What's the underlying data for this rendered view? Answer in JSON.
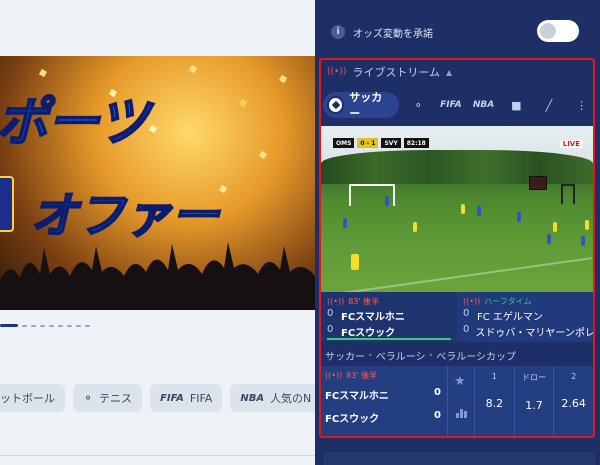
{
  "left": {
    "banner": {
      "title_line1": "ポーツ",
      "title_line2": "オファー"
    },
    "chips": [
      {
        "label": "ットボール",
        "icon": "soccer-icon"
      },
      {
        "label": "テニス",
        "icon": "tennis-icon"
      },
      {
        "logo": "FIFA",
        "label": "FIFA",
        "icon": "fifa-logo"
      },
      {
        "logo": "NBA",
        "label": "人気のN",
        "icon": "nba-logo"
      }
    ]
  },
  "right": {
    "odds_change_label": "オッズ変動を承諾",
    "toggle_on": false,
    "live": {
      "title": "ライブストリーム",
      "active_sport": "サッカー",
      "sport_icons": [
        "tennis-icon",
        "fifa-logo",
        "nba-logo",
        "ice-hockey-icon",
        "cricket-icon",
        "more-icon"
      ],
      "video": {
        "scorebug_team1": "OMS",
        "scorebug_score": "0 - 1",
        "scorebug_team2": "SVY",
        "scorebug_time": "82:18",
        "live_tag": "LIVE"
      },
      "matches": [
        {
          "status": "83' 後半",
          "status_color": "red",
          "teams": [
            {
              "score": "0",
              "name": "FCスマルホニ"
            },
            {
              "score": "0",
              "name": "FCスウック"
            }
          ]
        },
        {
          "status": "ハーフタイム",
          "status_color": "green",
          "teams": [
            {
              "score": "0",
              "name": "FC エゲルマン"
            },
            {
              "score": "0",
              "name": "スドゥバ・マリヤーンポレ"
            }
          ]
        }
      ],
      "league_path": [
        "サッカー",
        "ベラルーシ",
        "ベラルーシカップ"
      ],
      "bet": {
        "status": "83' 後半",
        "teams": [
          {
            "name": "FCスマルホニ",
            "score": "0"
          },
          {
            "name": "FCスウック",
            "score": "0"
          }
        ],
        "odds": [
          {
            "header": "1",
            "value": "8.2"
          },
          {
            "header": "ドロー",
            "value": "1.7"
          },
          {
            "header": "2",
            "value": "2.64"
          }
        ]
      }
    }
  }
}
